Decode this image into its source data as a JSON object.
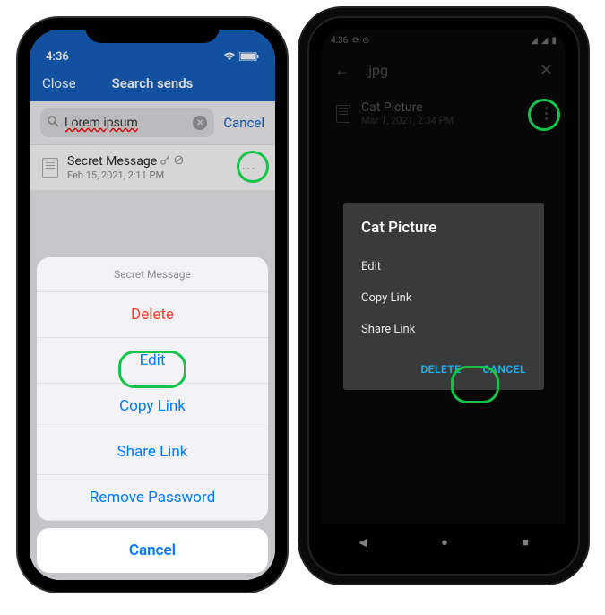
{
  "ios": {
    "statusbar": {
      "time": "4:36"
    },
    "nav": {
      "close": "Close",
      "title": "Search sends"
    },
    "search": {
      "query": "Lorem ipsum",
      "cancel": "Cancel"
    },
    "row": {
      "title": "Secret Message",
      "subtitle": "Feb 15, 2021, 2:11 PM"
    },
    "sheet": {
      "header": "Secret Message",
      "delete": "Delete",
      "edit": "Edit",
      "copyLink": "Copy Link",
      "shareLink": "Share Link",
      "removePassword": "Remove Password",
      "cancel": "Cancel"
    }
  },
  "android": {
    "statusbar": {
      "time": "4:36"
    },
    "topbar": {
      "title": ".jpg"
    },
    "row": {
      "title": "Cat Picture",
      "subtitle": "Mar 1, 2021, 2:34 PM"
    },
    "dialog": {
      "title": "Cat Picture",
      "edit": "Edit",
      "copyLink": "Copy Link",
      "shareLink": "Share Link",
      "delete": "DELETE",
      "cancel": "CANCEL"
    }
  }
}
